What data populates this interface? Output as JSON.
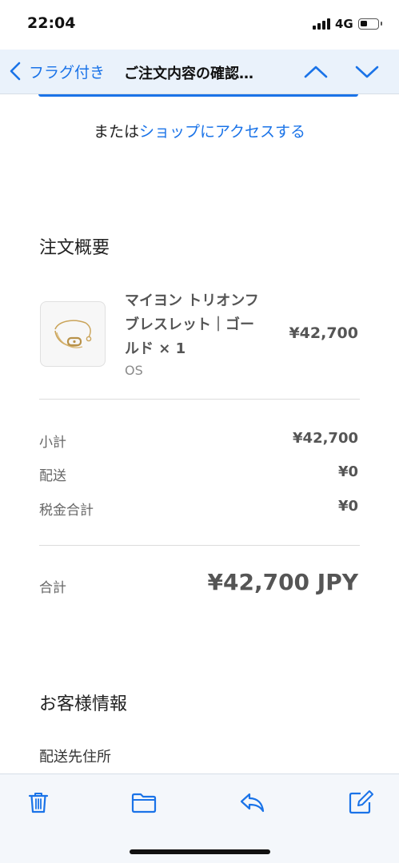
{
  "status_bar": {
    "time": "22:04",
    "network": "4G"
  },
  "nav": {
    "back_label": "フラグ付き",
    "title": "ご注文内容の確認…"
  },
  "shop_line": {
    "prefix": "または",
    "link": "ショップにアクセスする"
  },
  "order_summary": {
    "heading": "注文概要",
    "item": {
      "name_line1": "マイヨン トリオンフ",
      "name_line2": "ブレスレット｜ゴー",
      "name_line3": "ルド × 1",
      "variant": "OS",
      "price": "¥42,700"
    },
    "rows": [
      {
        "label": "小計",
        "value": "¥42,700"
      },
      {
        "label": "配送",
        "value": "¥0"
      },
      {
        "label": "税金合計",
        "value": "¥0"
      }
    ],
    "total_label": "合計",
    "total_value": "¥42,700 JPY"
  },
  "customer_info": {
    "heading": "お客様情報",
    "shipping_address_label": "配送先住所"
  },
  "colors": {
    "accent": "#1a73e8",
    "nav_bg": "#eaf2fb",
    "toolbar_bg": "#f4f7fb"
  },
  "toolbar_icons": [
    "trash-icon",
    "folder-icon",
    "reply-icon",
    "compose-icon"
  ]
}
